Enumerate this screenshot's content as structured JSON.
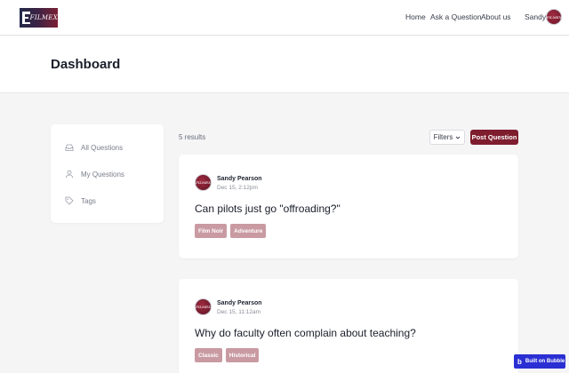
{
  "brand": {
    "logo_text": "FILMEX"
  },
  "nav": {
    "links": [
      "Home",
      "Ask a Question",
      "About us"
    ],
    "user_name": "Sandy"
  },
  "page": {
    "title": "Dashboard"
  },
  "sidebar": {
    "items": [
      {
        "label": "All Questions",
        "icon": "inbox-icon"
      },
      {
        "label": "My Questions",
        "icon": "user-icon"
      },
      {
        "label": "Tags",
        "icon": "tag-icon"
      }
    ]
  },
  "toolbar": {
    "results": "5 results",
    "filters_label": "Filters",
    "post_label": "Post Question"
  },
  "questions": [
    {
      "author": "Sandy Pearson",
      "date": "Dec 15, 2:12pm",
      "title": "Can pilots just go \"offroading?\"",
      "tags": [
        "Film Noir",
        "Adventure"
      ]
    },
    {
      "author": "Sandy Pearson",
      "date": "Dec 15, 11:12am",
      "title": "Why do faculty often complain about teaching?",
      "tags": [
        "Classic",
        "Historical"
      ]
    }
  ],
  "badge": {
    "label": "Built on Bubble",
    "glyph": "b"
  },
  "colors": {
    "accent": "#7e1d2e",
    "tag": "#c99aa2",
    "bubble": "#2a2fd3"
  }
}
